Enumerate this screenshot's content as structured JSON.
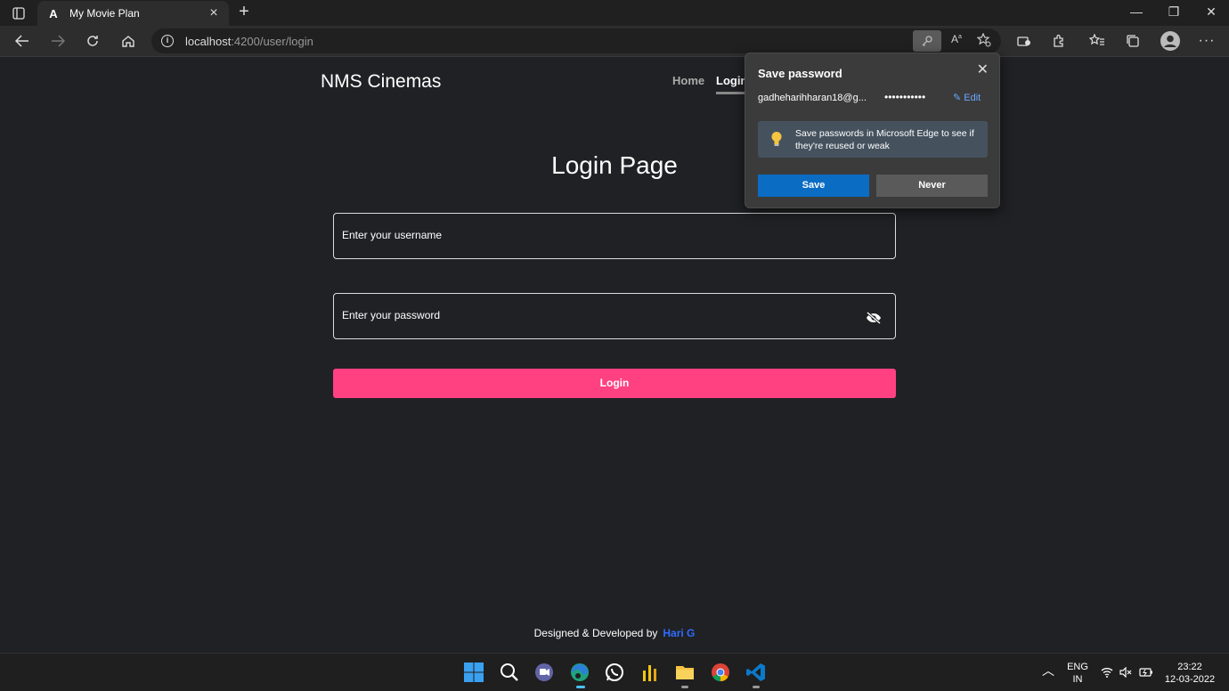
{
  "browser": {
    "tab": {
      "favicon": "A",
      "title": "My Movie Plan"
    },
    "url_host": "localhost",
    "url_rest": ":4200/user/login"
  },
  "site": {
    "brand": "NMS Cinemas",
    "nav": {
      "home": "Home",
      "login": "Login"
    },
    "page_title": "Login Page",
    "username_placeholder": "Enter your username",
    "password_placeholder": "Enter your password",
    "login_button": "Login",
    "footer_text": "Designed & Developed by",
    "footer_author": "Hari G",
    "accent_color": "#ff4081"
  },
  "popup": {
    "title": "Save password",
    "username": "gadheharihharan18@g...",
    "password_mask": "•••••••••••",
    "edit": "Edit",
    "tip": "Save passwords in Microsoft Edge to see if they're reused or weak",
    "save": "Save",
    "never": "Never"
  },
  "taskbar": {
    "lang_top": "ENG",
    "lang_bottom": "IN",
    "time": "23:22",
    "date": "12-03-2022"
  }
}
